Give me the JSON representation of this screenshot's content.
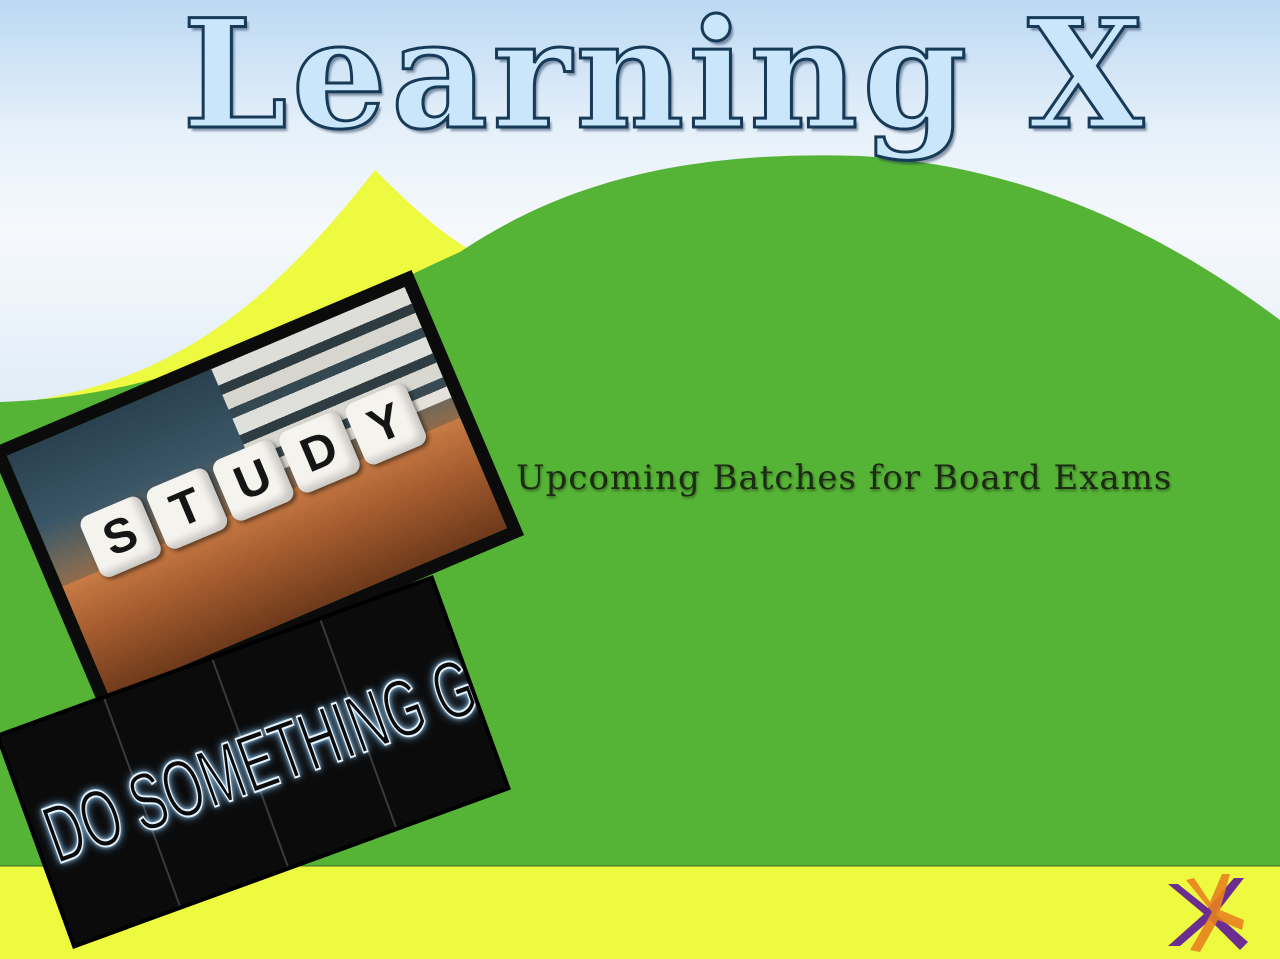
{
  "slide": {
    "title": "Learning X",
    "subtitle": "Upcoming Batches for Board Exams"
  },
  "study_image": {
    "dice_letters": [
      "S",
      "T",
      "U",
      "D",
      "Y"
    ]
  },
  "neon_image": {
    "text": "DO SOMETHING GREAT"
  },
  "colors": {
    "green": "#55b335",
    "yellow": "#eefa3f",
    "title_fill": "#c9e6fb",
    "title_outline": "#163a57",
    "logo_purple": "#6b2d8f",
    "logo_orange": "#e8821f"
  },
  "icons": {
    "logo": "x-logo-icon"
  }
}
